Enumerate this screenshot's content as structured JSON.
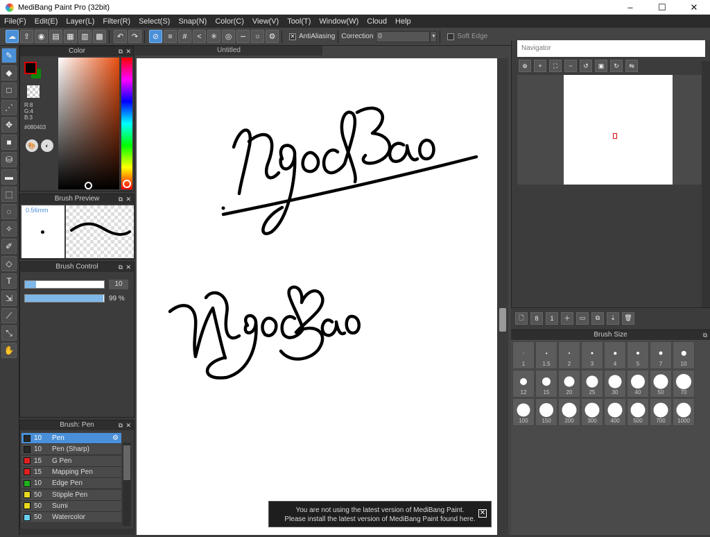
{
  "window": {
    "title": "MediBang Paint Pro (32bit)",
    "minimize": "–",
    "maximize": "☐",
    "close": "✕"
  },
  "menu": [
    "File(F)",
    "Edit(E)",
    "Layer(L)",
    "Filter(R)",
    "Select(S)",
    "Snap(N)",
    "Color(C)",
    "View(V)",
    "Tool(T)",
    "Window(W)",
    "Cloud",
    "Help"
  ],
  "toolbar": {
    "antialiasing_label": "AntiAliasing",
    "correction_label": "Correction",
    "correction_value": "0",
    "soft_edge_label": "Soft Edge"
  },
  "panels": {
    "color": {
      "title": "Color",
      "r": "R:8",
      "g": "G:4",
      "b": "B:3",
      "hex": "#080403",
      "fg": "#080403",
      "bg": "#0a8a0a"
    },
    "brush_preview": {
      "title": "Brush Preview",
      "size": "0.56mm"
    },
    "brush_control": {
      "title": "Brush Control",
      "size_value": "10",
      "opacity_value": "99 %",
      "size_fraction": 0.14,
      "opacity_fraction": 0.99
    },
    "brush_list": {
      "title": "Brush: Pen",
      "items": [
        {
          "size": "10",
          "name": "Pen",
          "color": "#2a2a2a"
        },
        {
          "size": "10",
          "name": "Pen (Sharp)",
          "color": "#2a2a2a"
        },
        {
          "size": "15",
          "name": "G Pen",
          "color": "#e02020"
        },
        {
          "size": "15",
          "name": "Mapping Pen",
          "color": "#e02020"
        },
        {
          "size": "10",
          "name": "Edge Pen",
          "color": "#20b020"
        },
        {
          "size": "50",
          "name": "Stipple Pen",
          "color": "#e8d820"
        },
        {
          "size": "50",
          "name": "Sumi",
          "color": "#e8d820"
        },
        {
          "size": "50",
          "name": "Watercolor",
          "color": "#6ad0f0"
        }
      ]
    }
  },
  "canvas": {
    "tab": "Untitled"
  },
  "notice": {
    "line1": "You are not using the latest version of MediBang Paint.",
    "line2": "Please install the latest version of MediBang Paint found here.",
    "close": "✕"
  },
  "navigator": {
    "title": "Navigator"
  },
  "brush_size": {
    "title": "Brush Size",
    "sizes": [
      "1",
      "1.5",
      "2",
      "3",
      "4",
      "5",
      "7",
      "10",
      "12",
      "15",
      "20",
      "25",
      "30",
      "40",
      "50",
      "70",
      "100",
      "150",
      "200",
      "300",
      "400",
      "500",
      "700",
      "1000"
    ]
  }
}
